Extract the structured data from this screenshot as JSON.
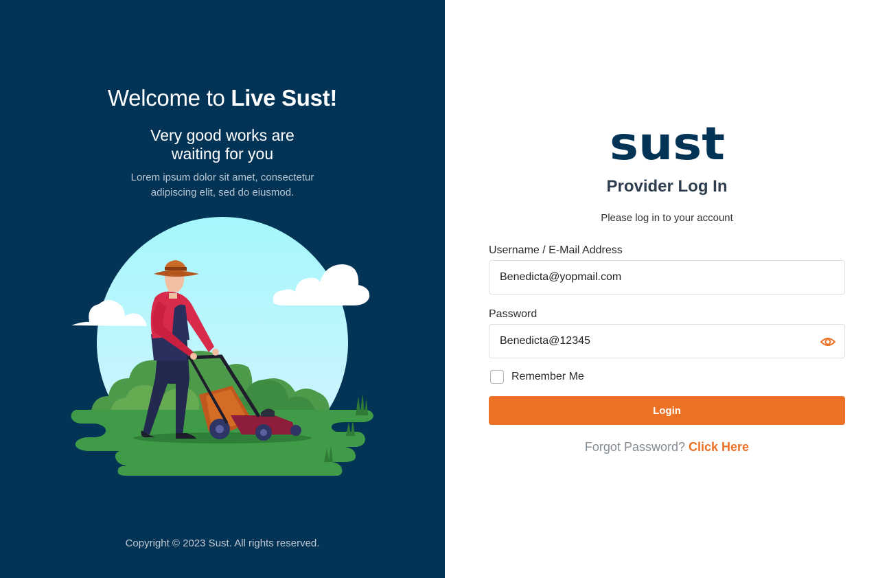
{
  "welcome": {
    "prefix": "Welcome to ",
    "brand": "Live Sust!",
    "subtitle_line1": "Very good works are",
    "subtitle_line2": "waiting for you",
    "lorem_line1": "Lorem ipsum dolor sit amet, consectetur",
    "lorem_line2": "adipiscing elit, sed do eiusmod.",
    "copyright": "Copyright © 2023 Sust. All rights reserved."
  },
  "logo": {
    "text": "sust",
    "color": "#033456"
  },
  "form": {
    "title": "Provider Log In",
    "subtitle": "Please log in to your account",
    "username_label": "Username / E-Mail Address",
    "username_value": "Benedicta@yopmail.com",
    "password_label": "Password",
    "password_value": "Benedicta@12345",
    "remember_label": "Remember Me",
    "remember_checked": false,
    "login_label": "Login",
    "forgot_text": "Forgot Password? ",
    "forgot_link": "Click Here"
  },
  "colors": {
    "left_bg": "#033456",
    "accent": "#ec7125",
    "title_text": "#2f3e4e"
  },
  "icons": {
    "password_toggle": "eye-icon",
    "illustration": "man-mowing-lawn-illustration"
  }
}
